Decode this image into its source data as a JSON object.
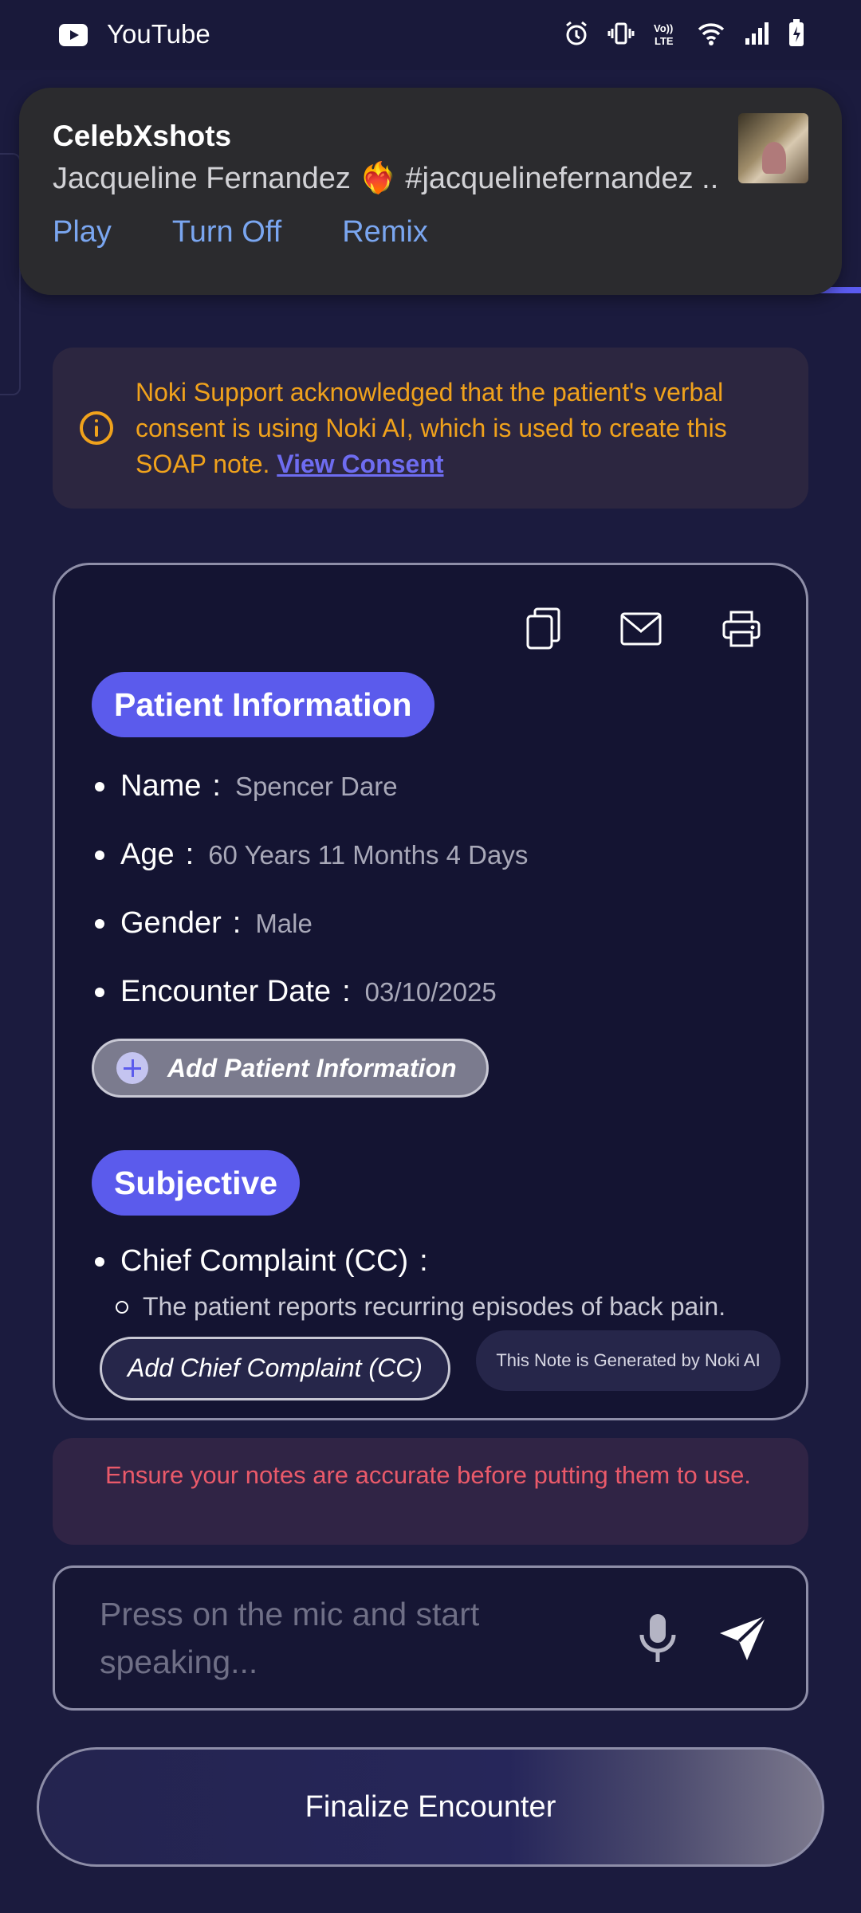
{
  "status_bar": {
    "app_name": "YouTube",
    "icons": [
      "alarm-icon",
      "vibrate-icon",
      "volte-icon",
      "wifi-icon",
      "signal-icon",
      "battery-icon"
    ]
  },
  "notification": {
    "title": "CelebXshots",
    "text": "Jacqueline Fernandez ❤️‍🔥 #jacquelinefernandez ..",
    "actions": [
      "Play",
      "Turn Off",
      "Remix"
    ]
  },
  "consent": {
    "text": "Noki Support acknowledged that the patient's verbal consent is using Noki AI, which is used to create this SOAP note. ",
    "link": "View Consent"
  },
  "note": {
    "toolbar": [
      "copy-icon",
      "mail-icon",
      "print-icon"
    ],
    "patient_section": {
      "title": "Patient Information",
      "fields": [
        {
          "label": "Name",
          "value": "Spencer Dare"
        },
        {
          "label": "Age",
          "value": "60 Years 11 Months 4 Days"
        },
        {
          "label": "Gender",
          "value": "Male"
        },
        {
          "label": "Encounter Date",
          "value": "03/10/2025"
        }
      ],
      "add_button": "Add Patient Information"
    },
    "subjective_section": {
      "title": "Subjective",
      "chief_complaint_label": "Chief Complaint (CC)",
      "chief_complaint_item": "The patient reports recurring episodes of back pain.",
      "add_button": "Add Chief Complaint (CC)"
    },
    "generated_badge": "This Note is Generated by Noki AI"
  },
  "warning": {
    "text": "Ensure your notes are accurate before putting them to use."
  },
  "input": {
    "placeholder": "Press on the mic and start speaking..."
  },
  "finalize_button": "Finalize Encounter",
  "colors": {
    "background": "#1b1b3e",
    "accent": "#5b5bec",
    "consent_text": "#f0a21c",
    "warning_text": "#ea5a6a",
    "link": "#6e6cf0"
  }
}
